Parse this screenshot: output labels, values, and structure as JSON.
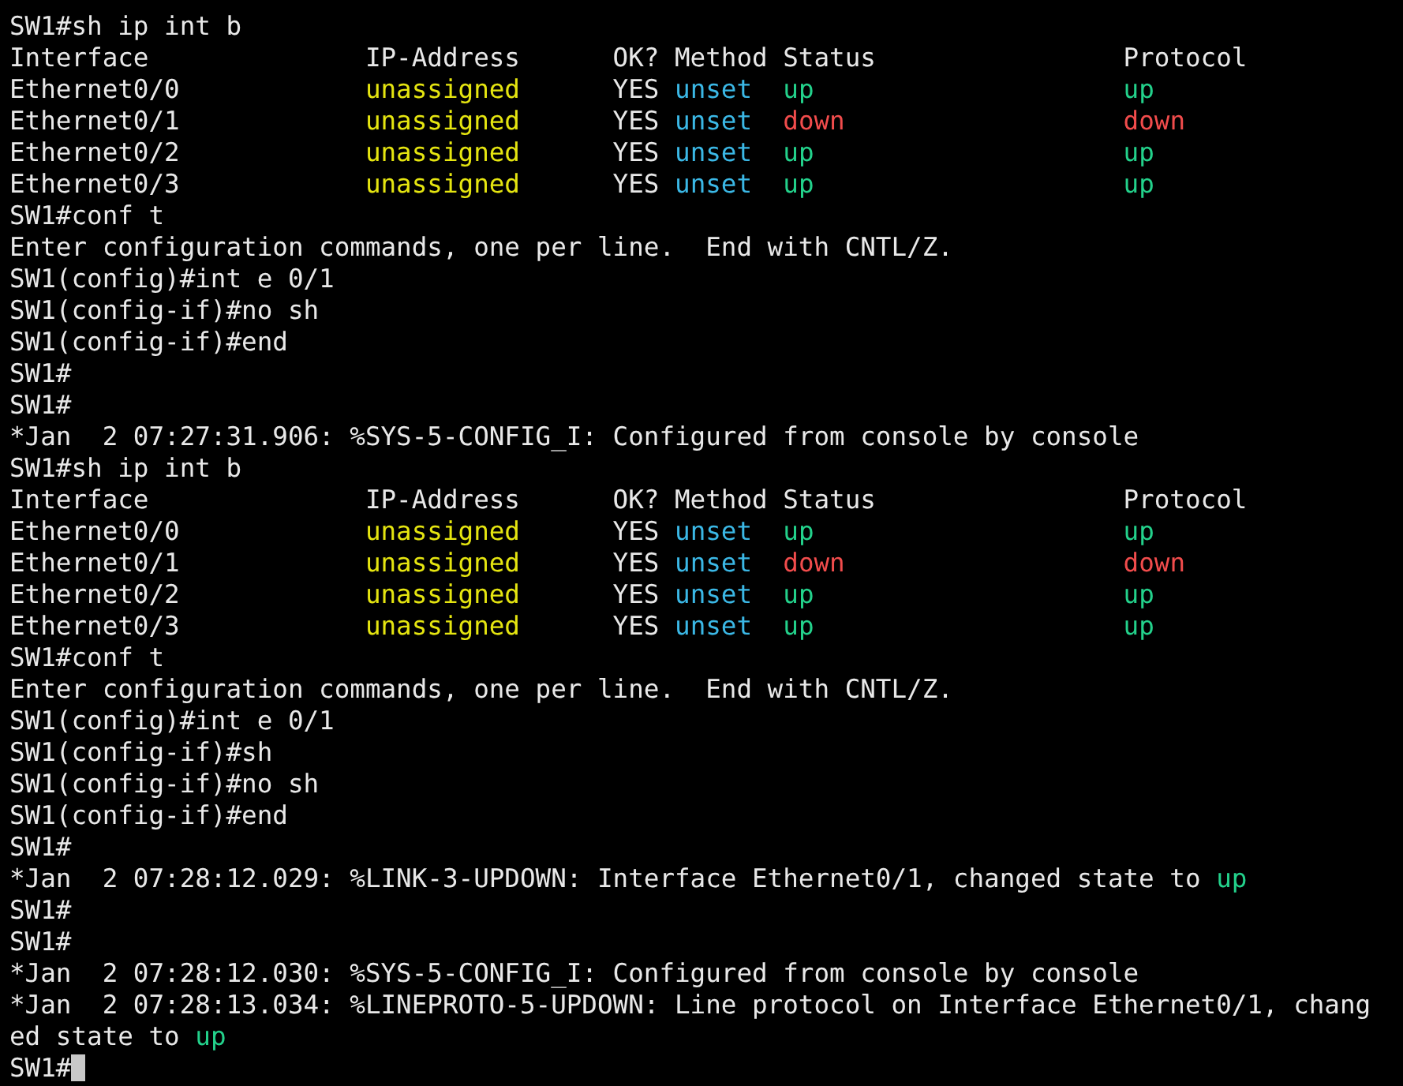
{
  "terminal": {
    "lines": [
      {
        "segments": [
          {
            "text": "SW1#sh ip int b"
          }
        ]
      },
      {
        "segments": [
          {
            "text": "Interface              IP-Address      OK? Method Status                Protocol"
          }
        ]
      },
      {
        "segments": [
          {
            "text": "Ethernet0/0            "
          },
          {
            "text": "unassigned",
            "color": "#e5e510"
          },
          {
            "text": "      YES "
          },
          {
            "text": "unset  ",
            "color": "#3bb8e6"
          },
          {
            "text": "up                    ",
            "color": "#23d18b"
          },
          {
            "text": "up",
            "color": "#23d18b"
          }
        ]
      },
      {
        "segments": [
          {
            "text": "Ethernet0/1            "
          },
          {
            "text": "unassigned",
            "color": "#e5e510"
          },
          {
            "text": "      YES "
          },
          {
            "text": "unset  ",
            "color": "#3bb8e6"
          },
          {
            "text": "down                  ",
            "color": "#f14c4c"
          },
          {
            "text": "down",
            "color": "#f14c4c"
          }
        ]
      },
      {
        "segments": [
          {
            "text": "Ethernet0/2            "
          },
          {
            "text": "unassigned",
            "color": "#e5e510"
          },
          {
            "text": "      YES "
          },
          {
            "text": "unset  ",
            "color": "#3bb8e6"
          },
          {
            "text": "up                    ",
            "color": "#23d18b"
          },
          {
            "text": "up",
            "color": "#23d18b"
          }
        ]
      },
      {
        "segments": [
          {
            "text": "Ethernet0/3            "
          },
          {
            "text": "unassigned",
            "color": "#e5e510"
          },
          {
            "text": "      YES "
          },
          {
            "text": "unset  ",
            "color": "#3bb8e6"
          },
          {
            "text": "up                    ",
            "color": "#23d18b"
          },
          {
            "text": "up",
            "color": "#23d18b"
          }
        ]
      },
      {
        "segments": [
          {
            "text": "SW1#conf t"
          }
        ]
      },
      {
        "segments": [
          {
            "text": "Enter configuration commands, one per line.  End with CNTL/Z."
          }
        ]
      },
      {
        "segments": [
          {
            "text": "SW1(config)#int e 0/1"
          }
        ]
      },
      {
        "segments": [
          {
            "text": "SW1(config-if)#no sh"
          }
        ]
      },
      {
        "segments": [
          {
            "text": "SW1(config-if)#end"
          }
        ]
      },
      {
        "segments": [
          {
            "text": "SW1#"
          }
        ]
      },
      {
        "segments": [
          {
            "text": "SW1#"
          }
        ]
      },
      {
        "segments": [
          {
            "text": "*Jan  2 07:27:31.906: %SYS-5-CONFIG_I: Configured from console by console"
          }
        ]
      },
      {
        "segments": [
          {
            "text": "SW1#sh ip int b"
          }
        ]
      },
      {
        "segments": [
          {
            "text": "Interface              IP-Address      OK? Method Status                Protocol"
          }
        ]
      },
      {
        "segments": [
          {
            "text": "Ethernet0/0            "
          },
          {
            "text": "unassigned",
            "color": "#e5e510"
          },
          {
            "text": "      YES "
          },
          {
            "text": "unset  ",
            "color": "#3bb8e6"
          },
          {
            "text": "up                    ",
            "color": "#23d18b"
          },
          {
            "text": "up",
            "color": "#23d18b"
          }
        ]
      },
      {
        "segments": [
          {
            "text": "Ethernet0/1            "
          },
          {
            "text": "unassigned",
            "color": "#e5e510"
          },
          {
            "text": "      YES "
          },
          {
            "text": "unset  ",
            "color": "#3bb8e6"
          },
          {
            "text": "down                  ",
            "color": "#f14c4c"
          },
          {
            "text": "down",
            "color": "#f14c4c"
          }
        ]
      },
      {
        "segments": [
          {
            "text": "Ethernet0/2            "
          },
          {
            "text": "unassigned",
            "color": "#e5e510"
          },
          {
            "text": "      YES "
          },
          {
            "text": "unset  ",
            "color": "#3bb8e6"
          },
          {
            "text": "up                    ",
            "color": "#23d18b"
          },
          {
            "text": "up",
            "color": "#23d18b"
          }
        ]
      },
      {
        "segments": [
          {
            "text": "Ethernet0/3            "
          },
          {
            "text": "unassigned",
            "color": "#e5e510"
          },
          {
            "text": "      YES "
          },
          {
            "text": "unset  ",
            "color": "#3bb8e6"
          },
          {
            "text": "up                    ",
            "color": "#23d18b"
          },
          {
            "text": "up",
            "color": "#23d18b"
          }
        ]
      },
      {
        "segments": [
          {
            "text": "SW1#conf t"
          }
        ]
      },
      {
        "segments": [
          {
            "text": "Enter configuration commands, one per line.  End with CNTL/Z."
          }
        ]
      },
      {
        "segments": [
          {
            "text": "SW1(config)#int e 0/1"
          }
        ]
      },
      {
        "segments": [
          {
            "text": "SW1(config-if)#sh"
          }
        ]
      },
      {
        "segments": [
          {
            "text": "SW1(config-if)#no sh"
          }
        ]
      },
      {
        "segments": [
          {
            "text": "SW1(config-if)#end"
          }
        ]
      },
      {
        "segments": [
          {
            "text": "SW1#"
          }
        ]
      },
      {
        "segments": [
          {
            "text": "*Jan  2 07:28:12.029: %LINK-3-UPDOWN: Interface Ethernet0/1, changed state to "
          },
          {
            "text": "up",
            "color": "#23d18b"
          }
        ]
      },
      {
        "segments": [
          {
            "text": "SW1#"
          }
        ]
      },
      {
        "segments": [
          {
            "text": "SW1#"
          }
        ]
      },
      {
        "segments": [
          {
            "text": "*Jan  2 07:28:12.030: %SYS-5-CONFIG_I: Configured from console by console"
          }
        ]
      },
      {
        "segments": [
          {
            "text": "*Jan  2 07:28:13.034: %LINEPROTO-5-UPDOWN: Line protocol on Interface Ethernet0/1, chang"
          }
        ]
      },
      {
        "segments": [
          {
            "text": "ed state to "
          },
          {
            "text": "up",
            "color": "#23d18b"
          }
        ]
      },
      {
        "segments": [
          {
            "text": "SW1#"
          }
        ]
      }
    ]
  }
}
